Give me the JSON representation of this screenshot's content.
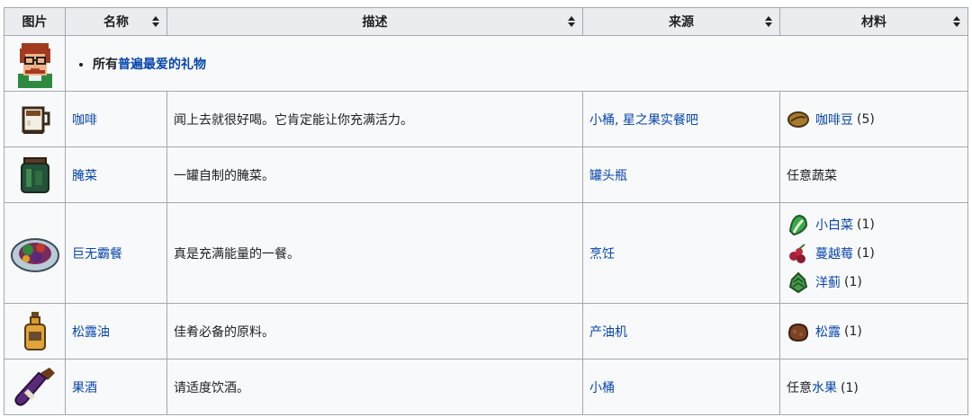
{
  "headers": {
    "image": "图片",
    "name": "名称",
    "desc": "描述",
    "source": "来源",
    "material": "材料"
  },
  "universal_row": {
    "prefix": "所有",
    "link": "普遍最爱的礼物"
  },
  "rows": [
    {
      "icon": "coffee-icon",
      "name": "咖啡",
      "desc": "闻上去就很好喝。它肯定能让你充满活力。",
      "sources": [
        "小桶",
        "星之果实餐吧"
      ],
      "source_sep": ", ",
      "materials": [
        {
          "icon": "coffee-bean-icon",
          "name": "咖啡豆",
          "qty": "(5)"
        }
      ]
    },
    {
      "icon": "pickles-icon",
      "name": "腌菜",
      "desc": "一罐自制的腌菜。",
      "sources": [
        "罐头瓶"
      ],
      "material_text": "任意蔬菜"
    },
    {
      "icon": "super-meal-icon",
      "name": "巨无霸餐",
      "desc": "真是充满能量的一餐。",
      "sources": [
        "烹饪"
      ],
      "materials": [
        {
          "icon": "bok-choy-icon",
          "name": "小白菜",
          "qty": "(1)"
        },
        {
          "icon": "cranberries-icon",
          "name": "蔓越莓",
          "qty": "(1)"
        },
        {
          "icon": "artichoke-icon",
          "name": "洋蓟",
          "qty": "(1)"
        }
      ]
    },
    {
      "icon": "truffle-oil-icon",
      "name": "松露油",
      "desc": "佳肴必备的原料。",
      "sources": [
        "产油机"
      ],
      "materials": [
        {
          "icon": "truffle-icon",
          "name": "松露",
          "qty": "(1)"
        }
      ]
    },
    {
      "icon": "wine-icon",
      "name": "果酒",
      "desc": "请适度饮酒。",
      "sources": [
        "小桶"
      ],
      "material_prefix": "任意",
      "material_link": "水果",
      "material_qty": "(1)"
    }
  ]
}
